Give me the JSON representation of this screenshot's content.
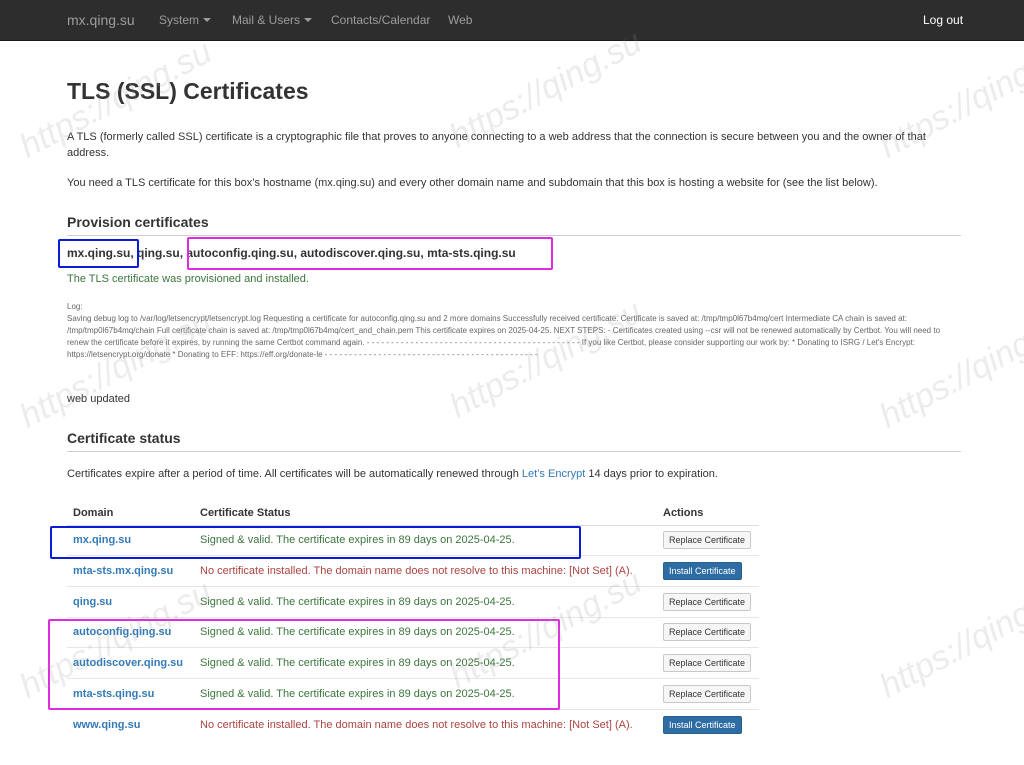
{
  "nav": {
    "brand": "mx.qing.su",
    "system": "System",
    "mail_users": "Mail & Users",
    "contacts": "Contacts/Calendar",
    "web": "Web",
    "logout": "Log out"
  },
  "page": {
    "title": "TLS (SSL) Certificates",
    "intro": "A TLS (formerly called SSL) certificate is a cryptographic file that proves to anyone connecting to a web address that the connection is secure between you and the owner of that address.",
    "need": "You need a TLS certificate for this box’s hostname (mx.qing.su) and every other domain name and subdomain that this box is hosting a website for (see the list below)."
  },
  "provision": {
    "heading": "Provision certificates",
    "domains": {
      "d1": "mx.qing.su",
      "sep1": ", ",
      "d2": "qing.su",
      "sep2": ", ",
      "d3": "autoconfig.qing.su",
      "sep3": ", ",
      "d4": "autodiscover.qing.su",
      "sep4": ", ",
      "d5": "mta-sts.qing.su"
    },
    "success": "The TLS certificate was provisioned and installed.",
    "log_label": "Log:",
    "log": "Saving debug log to /var/log/letsencrypt/letsencrypt.log Requesting a certificate for autoconfig.qing.su and 2 more domains Successfully received certificate. Certificate is saved at: /tmp/tmp0l67b4mq/cert Intermediate CA chain is saved at: /tmp/tmp0l67b4mq/chain Full certificate chain is saved at: /tmp/tmp0l67b4mq/cert_and_chain.pem This certificate expires on 2025-04-25. NEXT STEPS: - Certificates created using --csr will not be renewed automatically by Certbot. You will need to renew the certificate before it expires, by running the same Certbot command again. - - - - - - - - - - - - - - - - - - - - - - - - - - - - - - - - - - - - - - - - - - - - If you like Certbot, please consider supporting our work by: * Donating to ISRG / Let's Encrypt: https://letsencrypt.org/donate * Donating to EFF: https://eff.org/donate-le - - - - - - - - - - - - - - - - - - - - - - - - - - - - - - - - - - - - - - - - - - - -",
    "web_updated": "web updated"
  },
  "status_section": {
    "heading": "Certificate status",
    "desc_before": "Certificates expire after a period of time. All certificates will be automatically renewed through ",
    "desc_link": "Let’s Encrypt",
    "desc_after": " 14 days prior to expiration."
  },
  "table": {
    "headers": {
      "domain": "Domain",
      "status": "Certificate Status",
      "actions": "Actions"
    },
    "rows": [
      {
        "domain": "mx.qing.su",
        "status": "Signed & valid. The certificate expires in 89 days on 2025-04-25.",
        "action": "Replace Certificate"
      },
      {
        "domain": "mta-sts.mx.qing.su",
        "status": "No certificate installed. The domain name does not resolve to this machine: [Not Set] (A).",
        "action": "Install Certificate"
      },
      {
        "domain": "qing.su",
        "status": "Signed & valid. The certificate expires in 89 days on 2025-04-25.",
        "action": "Replace Certificate"
      },
      {
        "domain": "autoconfig.qing.su",
        "status": "Signed & valid. The certificate expires in 89 days on 2025-04-25.",
        "action": "Replace Certificate"
      },
      {
        "domain": "autodiscover.qing.su",
        "status": "Signed & valid. The certificate expires in 89 days on 2025-04-25.",
        "action": "Replace Certificate"
      },
      {
        "domain": "mta-sts.qing.su",
        "status": "Signed & valid. The certificate expires in 89 days on 2025-04-25.",
        "action": "Replace Certificate"
      },
      {
        "domain": "www.qing.su",
        "status": "No certificate installed. The domain name does not resolve to this machine: [Not Set] (A).",
        "action": "Install Certificate"
      }
    ]
  },
  "watermark": "https://qing.su",
  "colors": {
    "navbar": "#2d2d2d",
    "link": "#337ab7",
    "success": "#3c763d",
    "error": "#a94442",
    "highlight_blue": "#0b1bd6",
    "highlight_pink": "#e12be0"
  }
}
